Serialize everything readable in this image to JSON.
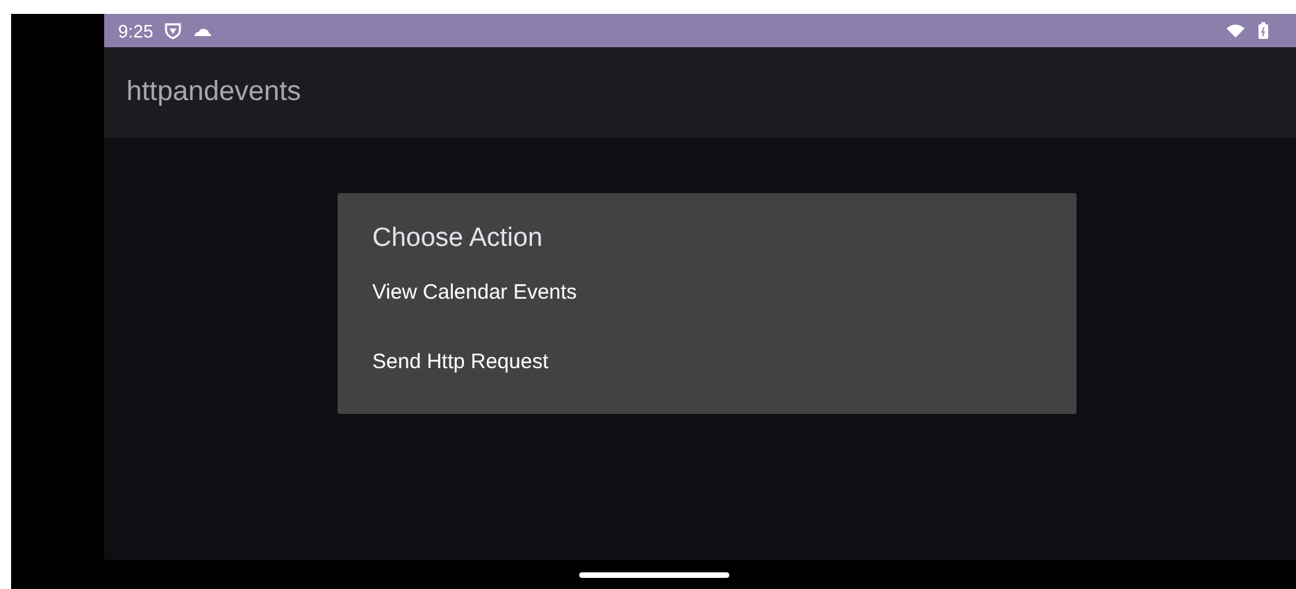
{
  "status_bar": {
    "time": "9:25"
  },
  "app_bar": {
    "title": "httpandevents"
  },
  "dialog": {
    "title": "Choose Action",
    "items": [
      {
        "label": "View Calendar Events"
      },
      {
        "label": "Send Http Request"
      }
    ]
  }
}
